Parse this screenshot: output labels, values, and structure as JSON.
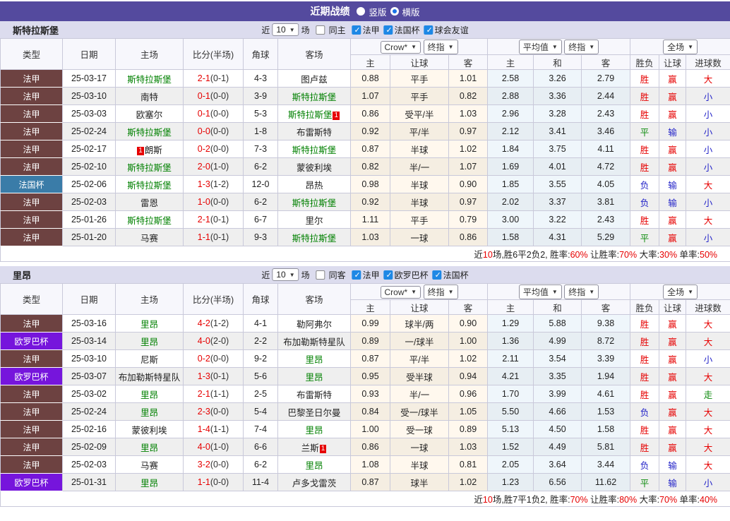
{
  "title_bar": {
    "title": "近期战绩",
    "vertical_label": "竖版",
    "horizontal_label": "横版",
    "selected_layout": "横版"
  },
  "colors": {
    "titlebar_purple": "#544A9E",
    "band_lavender": "#DCDCEE",
    "type": {
      "ligue1": "#6D4241",
      "coupe": "#3A7CA8",
      "europa": "#7615DC"
    },
    "outcome": {
      "r": "#E60000",
      "b": "#2323C8",
      "g": "#0B8A0B"
    },
    "team_focus_green": "#008000",
    "score_red": "#E60000",
    "checkbox_blue": "#1E88E5"
  },
  "tables": [
    {
      "team": "斯特拉斯堡",
      "filter": {
        "prefix": "近",
        "count": "10",
        "suffix": "场",
        "same_label": "同主",
        "competitions": [
          "法甲",
          "法国杯",
          "球会友谊"
        ]
      },
      "header": {
        "cols": [
          "类型",
          "日期",
          "主场",
          "比分(半场)",
          "角球",
          "客场"
        ],
        "select1": "Crow*",
        "select2": "终指",
        "sub1": [
          "主",
          "让球",
          "客"
        ],
        "select3": "平均值",
        "select4": "终指",
        "sub2": [
          "主",
          "和",
          "客"
        ],
        "select5": "全场",
        "sub3": [
          "胜负",
          "让球",
          "进球数"
        ]
      },
      "rows": [
        {
          "type": "法甲",
          "type_key": "ligue1",
          "date": "25-03-17",
          "home": "斯特拉斯堡",
          "home_focus": true,
          "score": "2-1",
          "half": "(0-1)",
          "corner": "4-3",
          "away": "图卢兹",
          "let": [
            "0.88",
            "平手",
            "1.01"
          ],
          "avg": [
            "2.58",
            "3.26",
            "2.79"
          ],
          "result": [
            {
              "t": "胜",
              "c": "r"
            },
            {
              "t": "赢",
              "c": "r"
            },
            {
              "t": "大",
              "c": "r"
            }
          ]
        },
        {
          "type": "法甲",
          "type_key": "ligue1",
          "date": "25-03-10",
          "home": "南特",
          "score": "0-1",
          "half": "(0-0)",
          "corner": "3-9",
          "away": "斯特拉斯堡",
          "away_focus": true,
          "let": [
            "1.07",
            "平手",
            "0.82"
          ],
          "avg": [
            "2.88",
            "3.36",
            "2.44"
          ],
          "result": [
            {
              "t": "胜",
              "c": "r"
            },
            {
              "t": "赢",
              "c": "r"
            },
            {
              "t": "小",
              "c": "b"
            }
          ]
        },
        {
          "type": "法甲",
          "type_key": "ligue1",
          "date": "25-03-03",
          "home": "欧塞尔",
          "score": "0-1",
          "half": "(0-0)",
          "corner": "5-3",
          "away": "斯特拉斯堡",
          "away_focus": true,
          "away_badge_post": "1",
          "let": [
            "0.86",
            "受平/半",
            "1.03"
          ],
          "avg": [
            "2.96",
            "3.28",
            "2.43"
          ],
          "result": [
            {
              "t": "胜",
              "c": "r"
            },
            {
              "t": "赢",
              "c": "r"
            },
            {
              "t": "小",
              "c": "b"
            }
          ]
        },
        {
          "type": "法甲",
          "type_key": "ligue1",
          "date": "25-02-24",
          "home": "斯特拉斯堡",
          "home_focus": true,
          "score": "0-0",
          "half": "(0-0)",
          "corner": "1-8",
          "away": "布雷斯特",
          "let": [
            "0.92",
            "平/半",
            "0.97"
          ],
          "avg": [
            "2.12",
            "3.41",
            "3.46"
          ],
          "result": [
            {
              "t": "平",
              "c": "g"
            },
            {
              "t": "输",
              "c": "b"
            },
            {
              "t": "小",
              "c": "b"
            }
          ]
        },
        {
          "type": "法甲",
          "type_key": "ligue1",
          "date": "25-02-17",
          "home": "朗斯",
          "home_badge_pre": "1",
          "score": "0-2",
          "half": "(0-0)",
          "corner": "7-3",
          "away": "斯特拉斯堡",
          "away_focus": true,
          "let": [
            "0.87",
            "半球",
            "1.02"
          ],
          "avg": [
            "1.84",
            "3.75",
            "4.11"
          ],
          "result": [
            {
              "t": "胜",
              "c": "r"
            },
            {
              "t": "赢",
              "c": "r"
            },
            {
              "t": "小",
              "c": "b"
            }
          ]
        },
        {
          "type": "法甲",
          "type_key": "ligue1",
          "date": "25-02-10",
          "home": "斯特拉斯堡",
          "home_focus": true,
          "score": "2-0",
          "half": "(1-0)",
          "corner": "6-2",
          "away": "蒙彼利埃",
          "let": [
            "0.82",
            "半/一",
            "1.07"
          ],
          "avg": [
            "1.69",
            "4.01",
            "4.72"
          ],
          "result": [
            {
              "t": "胜",
              "c": "r"
            },
            {
              "t": "赢",
              "c": "r"
            },
            {
              "t": "小",
              "c": "b"
            }
          ]
        },
        {
          "type": "法国杯",
          "type_key": "coupe",
          "date": "25-02-06",
          "home": "斯特拉斯堡",
          "home_focus": true,
          "score": "1-3",
          "half": "(1-2)",
          "corner": "12-0",
          "away": "昂热",
          "let": [
            "0.98",
            "半球",
            "0.90"
          ],
          "avg": [
            "1.85",
            "3.55",
            "4.05"
          ],
          "result": [
            {
              "t": "负",
              "c": "b"
            },
            {
              "t": "输",
              "c": "b"
            },
            {
              "t": "大",
              "c": "r"
            }
          ]
        },
        {
          "type": "法甲",
          "type_key": "ligue1",
          "date": "25-02-03",
          "home": "雷恩",
          "score": "1-0",
          "half": "(0-0)",
          "corner": "6-2",
          "away": "斯特拉斯堡",
          "away_focus": true,
          "let": [
            "0.92",
            "半球",
            "0.97"
          ],
          "avg": [
            "2.02",
            "3.37",
            "3.81"
          ],
          "result": [
            {
              "t": "负",
              "c": "b"
            },
            {
              "t": "输",
              "c": "b"
            },
            {
              "t": "小",
              "c": "b"
            }
          ]
        },
        {
          "type": "法甲",
          "type_key": "ligue1",
          "date": "25-01-26",
          "home": "斯特拉斯堡",
          "home_focus": true,
          "score": "2-1",
          "half": "(0-1)",
          "corner": "6-7",
          "away": "里尔",
          "let": [
            "1.11",
            "平手",
            "0.79"
          ],
          "avg": [
            "3.00",
            "3.22",
            "2.43"
          ],
          "result": [
            {
              "t": "胜",
              "c": "r"
            },
            {
              "t": "赢",
              "c": "r"
            },
            {
              "t": "大",
              "c": "r"
            }
          ]
        },
        {
          "type": "法甲",
          "type_key": "ligue1",
          "date": "25-01-20",
          "home": "马赛",
          "score": "1-1",
          "half": "(0-1)",
          "corner": "9-3",
          "away": "斯特拉斯堡",
          "away_focus": true,
          "let": [
            "1.03",
            "一球",
            "0.86"
          ],
          "avg": [
            "1.58",
            "4.31",
            "5.29"
          ],
          "result": [
            {
              "t": "平",
              "c": "g"
            },
            {
              "t": "赢",
              "c": "r"
            },
            {
              "t": "小",
              "c": "b"
            }
          ]
        }
      ],
      "summary": [
        {
          "t": "近",
          "c": "k"
        },
        {
          "t": "10",
          "c": "r"
        },
        {
          "t": "场,胜6平2负2, 胜率:",
          "c": "k"
        },
        {
          "t": "60%",
          "c": "r"
        },
        {
          "t": " 让胜率:",
          "c": "k"
        },
        {
          "t": "70%",
          "c": "r"
        },
        {
          "t": " 大率:",
          "c": "k"
        },
        {
          "t": "30%",
          "c": "r"
        },
        {
          "t": " 单率:",
          "c": "k"
        },
        {
          "t": "50%",
          "c": "r"
        }
      ]
    },
    {
      "team": "里昂",
      "filter": {
        "prefix": "近",
        "count": "10",
        "suffix": "场",
        "same_label": "同客",
        "competitions": [
          "法甲",
          "欧罗巴杯",
          "法国杯"
        ]
      },
      "header": {
        "cols": [
          "类型",
          "日期",
          "主场",
          "比分(半场)",
          "角球",
          "客场"
        ],
        "select1": "Crow*",
        "select2": "终指",
        "sub1": [
          "主",
          "让球",
          "客"
        ],
        "select3": "平均值",
        "select4": "终指",
        "sub2": [
          "主",
          "和",
          "客"
        ],
        "select5": "全场",
        "sub3": [
          "胜负",
          "让球",
          "进球数"
        ]
      },
      "rows": [
        {
          "type": "法甲",
          "type_key": "ligue1",
          "date": "25-03-16",
          "home": "里昂",
          "home_focus": true,
          "score": "4-2",
          "half": "(1-2)",
          "corner": "4-1",
          "away": "勒阿弗尔",
          "let": [
            "0.99",
            "球半/两",
            "0.90"
          ],
          "avg": [
            "1.29",
            "5.88",
            "9.38"
          ],
          "result": [
            {
              "t": "胜",
              "c": "r"
            },
            {
              "t": "赢",
              "c": "r"
            },
            {
              "t": "大",
              "c": "r"
            }
          ]
        },
        {
          "type": "欧罗巴杯",
          "type_key": "europa",
          "date": "25-03-14",
          "home": "里昂",
          "home_focus": true,
          "score": "4-0",
          "half": "(2-0)",
          "corner": "2-2",
          "away": "布加勒斯特星队",
          "let": [
            "0.89",
            "一/球半",
            "1.00"
          ],
          "avg": [
            "1.36",
            "4.99",
            "8.72"
          ],
          "result": [
            {
              "t": "胜",
              "c": "r"
            },
            {
              "t": "赢",
              "c": "r"
            },
            {
              "t": "大",
              "c": "r"
            }
          ]
        },
        {
          "type": "法甲",
          "type_key": "ligue1",
          "date": "25-03-10",
          "home": "尼斯",
          "score": "0-2",
          "half": "(0-0)",
          "corner": "9-2",
          "away": "里昂",
          "away_focus": true,
          "let": [
            "0.87",
            "平/半",
            "1.02"
          ],
          "avg": [
            "2.11",
            "3.54",
            "3.39"
          ],
          "result": [
            {
              "t": "胜",
              "c": "r"
            },
            {
              "t": "赢",
              "c": "r"
            },
            {
              "t": "小",
              "c": "b"
            }
          ]
        },
        {
          "type": "欧罗巴杯",
          "type_key": "europa",
          "date": "25-03-07",
          "home": "布加勒斯特星队",
          "score": "1-3",
          "half": "(0-1)",
          "corner": "5-6",
          "away": "里昂",
          "away_focus": true,
          "let": [
            "0.95",
            "受半球",
            "0.94"
          ],
          "avg": [
            "4.21",
            "3.35",
            "1.94"
          ],
          "result": [
            {
              "t": "胜",
              "c": "r"
            },
            {
              "t": "赢",
              "c": "r"
            },
            {
              "t": "大",
              "c": "r"
            }
          ]
        },
        {
          "type": "法甲",
          "type_key": "ligue1",
          "date": "25-03-02",
          "home": "里昂",
          "home_focus": true,
          "score": "2-1",
          "half": "(1-1)",
          "corner": "2-5",
          "away": "布雷斯特",
          "let": [
            "0.93",
            "半/一",
            "0.96"
          ],
          "avg": [
            "1.70",
            "3.99",
            "4.61"
          ],
          "result": [
            {
              "t": "胜",
              "c": "r"
            },
            {
              "t": "赢",
              "c": "r"
            },
            {
              "t": "走",
              "c": "g"
            }
          ]
        },
        {
          "type": "法甲",
          "type_key": "ligue1",
          "date": "25-02-24",
          "home": "里昂",
          "home_focus": true,
          "score": "2-3",
          "half": "(0-0)",
          "corner": "5-4",
          "away": "巴黎圣日尔曼",
          "let": [
            "0.84",
            "受一/球半",
            "1.05"
          ],
          "avg": [
            "5.50",
            "4.66",
            "1.53"
          ],
          "result": [
            {
              "t": "负",
              "c": "b"
            },
            {
              "t": "赢",
              "c": "r"
            },
            {
              "t": "大",
              "c": "r"
            }
          ]
        },
        {
          "type": "法甲",
          "type_key": "ligue1",
          "date": "25-02-16",
          "home": "蒙彼利埃",
          "score": "1-4",
          "half": "(1-1)",
          "corner": "7-4",
          "away": "里昂",
          "away_focus": true,
          "let": [
            "1.00",
            "受一球",
            "0.89"
          ],
          "avg": [
            "5.13",
            "4.50",
            "1.58"
          ],
          "result": [
            {
              "t": "胜",
              "c": "r"
            },
            {
              "t": "赢",
              "c": "r"
            },
            {
              "t": "大",
              "c": "r"
            }
          ]
        },
        {
          "type": "法甲",
          "type_key": "ligue1",
          "date": "25-02-09",
          "home": "里昂",
          "home_focus": true,
          "score": "4-0",
          "half": "(1-0)",
          "corner": "6-6",
          "away": "兰斯",
          "away_badge_post": "1",
          "let": [
            "0.86",
            "一球",
            "1.03"
          ],
          "avg": [
            "1.52",
            "4.49",
            "5.81"
          ],
          "result": [
            {
              "t": "胜",
              "c": "r"
            },
            {
              "t": "赢",
              "c": "r"
            },
            {
              "t": "大",
              "c": "r"
            }
          ]
        },
        {
          "type": "法甲",
          "type_key": "ligue1",
          "date": "25-02-03",
          "home": "马赛",
          "score": "3-2",
          "half": "(0-0)",
          "corner": "6-2",
          "away": "里昂",
          "away_focus": true,
          "let": [
            "1.08",
            "半球",
            "0.81"
          ],
          "avg": [
            "2.05",
            "3.64",
            "3.44"
          ],
          "result": [
            {
              "t": "负",
              "c": "b"
            },
            {
              "t": "输",
              "c": "b"
            },
            {
              "t": "大",
              "c": "r"
            }
          ]
        },
        {
          "type": "欧罗巴杯",
          "type_key": "europa",
          "date": "25-01-31",
          "home": "里昂",
          "home_focus": true,
          "score": "1-1",
          "half": "(0-0)",
          "corner": "11-4",
          "away": "卢多戈雷茨",
          "let": [
            "0.87",
            "球半",
            "1.02"
          ],
          "avg": [
            "1.23",
            "6.56",
            "11.62"
          ],
          "result": [
            {
              "t": "平",
              "c": "g"
            },
            {
              "t": "输",
              "c": "b"
            },
            {
              "t": "小",
              "c": "b"
            }
          ]
        }
      ],
      "summary": [
        {
          "t": "近",
          "c": "k"
        },
        {
          "t": "10",
          "c": "r"
        },
        {
          "t": "场,胜7平1负2, 胜率:",
          "c": "k"
        },
        {
          "t": "70%",
          "c": "r"
        },
        {
          "t": " 让胜率:",
          "c": "k"
        },
        {
          "t": "80%",
          "c": "r"
        },
        {
          "t": " 大率:",
          "c": "k"
        },
        {
          "t": "70%",
          "c": "r"
        },
        {
          "t": " 单率:",
          "c": "k"
        },
        {
          "t": "40%",
          "c": "r"
        }
      ]
    }
  ]
}
